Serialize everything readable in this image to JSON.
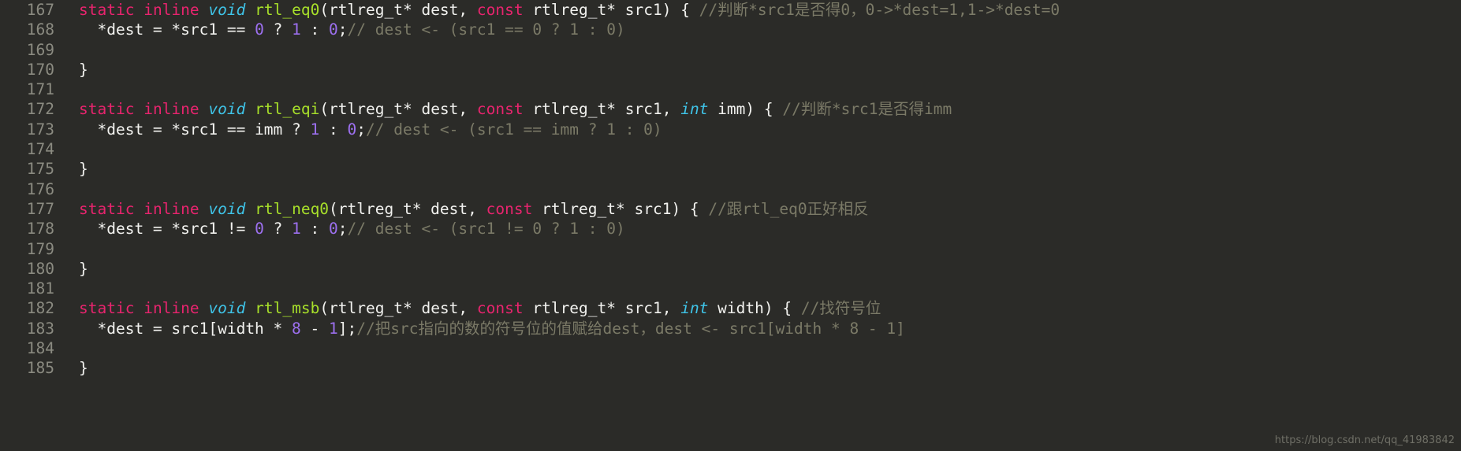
{
  "editor": {
    "background_color": "#2b2b28",
    "gutter_text_color": "#8b8b81",
    "font_size_px": 19.5,
    "line_height_px": 25.3,
    "palette": {
      "keyword": "#e8246e",
      "type": "#3fc4e8",
      "function": "#a8e02a",
      "plain": "#f2f2ef",
      "number": "#9d70f0",
      "comment": "#7b7a67"
    },
    "first_line_number": 167,
    "last_line_number": 185
  },
  "watermark": {
    "text": "https://blog.csdn.net/qq_41983842"
  },
  "lines": [
    {
      "num": "167",
      "guide": false,
      "tokens": [
        {
          "t": "static",
          "c": "kw"
        },
        {
          "t": " ",
          "c": "plain"
        },
        {
          "t": "inline",
          "c": "kw"
        },
        {
          "t": " ",
          "c": "plain"
        },
        {
          "t": "void",
          "c": "type"
        },
        {
          "t": " ",
          "c": "plain"
        },
        {
          "t": "rtl_eq0",
          "c": "fn"
        },
        {
          "t": "(rtlreg_t* dest, ",
          "c": "plain"
        },
        {
          "t": "const",
          "c": "kw"
        },
        {
          "t": " rtlreg_t* src1) { ",
          "c": "plain"
        },
        {
          "t": "//判断*src1是否得0，0->*dest=1,1->*dest=0",
          "c": "comment"
        }
      ]
    },
    {
      "num": "168",
      "guide": true,
      "tokens": [
        {
          "t": "  *dest = *src1 == ",
          "c": "plain"
        },
        {
          "t": "0",
          "c": "num"
        },
        {
          "t": " ? ",
          "c": "plain"
        },
        {
          "t": "1",
          "c": "num"
        },
        {
          "t": " : ",
          "c": "plain"
        },
        {
          "t": "0",
          "c": "num"
        },
        {
          "t": ";",
          "c": "plain"
        },
        {
          "t": "// dest <- (src1 == 0 ? 1 : 0)",
          "c": "comment"
        }
      ]
    },
    {
      "num": "169",
      "guide": false,
      "tokens": []
    },
    {
      "num": "170",
      "guide": false,
      "tokens": [
        {
          "t": "}",
          "c": "plain"
        }
      ]
    },
    {
      "num": "171",
      "guide": false,
      "tokens": []
    },
    {
      "num": "172",
      "guide": false,
      "tokens": [
        {
          "t": "static",
          "c": "kw"
        },
        {
          "t": " ",
          "c": "plain"
        },
        {
          "t": "inline",
          "c": "kw"
        },
        {
          "t": " ",
          "c": "plain"
        },
        {
          "t": "void",
          "c": "type"
        },
        {
          "t": " ",
          "c": "plain"
        },
        {
          "t": "rtl_eqi",
          "c": "fn"
        },
        {
          "t": "(rtlreg_t* dest, ",
          "c": "plain"
        },
        {
          "t": "const",
          "c": "kw"
        },
        {
          "t": " rtlreg_t* src1, ",
          "c": "plain"
        },
        {
          "t": "int",
          "c": "type"
        },
        {
          "t": " imm) { ",
          "c": "plain"
        },
        {
          "t": "//判断*src1是否得imm",
          "c": "comment"
        }
      ]
    },
    {
      "num": "173",
      "guide": true,
      "tokens": [
        {
          "t": "  *dest = *src1 == imm ? ",
          "c": "plain"
        },
        {
          "t": "1",
          "c": "num"
        },
        {
          "t": " : ",
          "c": "plain"
        },
        {
          "t": "0",
          "c": "num"
        },
        {
          "t": ";",
          "c": "plain"
        },
        {
          "t": "// dest <- (src1 == imm ? 1 : 0)",
          "c": "comment"
        }
      ]
    },
    {
      "num": "174",
      "guide": false,
      "tokens": []
    },
    {
      "num": "175",
      "guide": false,
      "tokens": [
        {
          "t": "}",
          "c": "plain"
        }
      ]
    },
    {
      "num": "176",
      "guide": false,
      "tokens": []
    },
    {
      "num": "177",
      "guide": false,
      "tokens": [
        {
          "t": "static",
          "c": "kw"
        },
        {
          "t": " ",
          "c": "plain"
        },
        {
          "t": "inline",
          "c": "kw"
        },
        {
          "t": " ",
          "c": "plain"
        },
        {
          "t": "void",
          "c": "type"
        },
        {
          "t": " ",
          "c": "plain"
        },
        {
          "t": "rtl_neq0",
          "c": "fn"
        },
        {
          "t": "(rtlreg_t* dest, ",
          "c": "plain"
        },
        {
          "t": "const",
          "c": "kw"
        },
        {
          "t": " rtlreg_t* src1) { ",
          "c": "plain"
        },
        {
          "t": "//跟rtl_eq0正好相反",
          "c": "comment"
        }
      ]
    },
    {
      "num": "178",
      "guide": true,
      "tokens": [
        {
          "t": "  *dest = *src1 != ",
          "c": "plain"
        },
        {
          "t": "0",
          "c": "num"
        },
        {
          "t": " ? ",
          "c": "plain"
        },
        {
          "t": "1",
          "c": "num"
        },
        {
          "t": " : ",
          "c": "plain"
        },
        {
          "t": "0",
          "c": "num"
        },
        {
          "t": ";",
          "c": "plain"
        },
        {
          "t": "// dest <- (src1 != 0 ? 1 : 0)",
          "c": "comment"
        }
      ]
    },
    {
      "num": "179",
      "guide": false,
      "tokens": []
    },
    {
      "num": "180",
      "guide": false,
      "tokens": [
        {
          "t": "}",
          "c": "plain"
        }
      ]
    },
    {
      "num": "181",
      "guide": false,
      "tokens": []
    },
    {
      "num": "182",
      "guide": false,
      "tokens": [
        {
          "t": "static",
          "c": "kw"
        },
        {
          "t": " ",
          "c": "plain"
        },
        {
          "t": "inline",
          "c": "kw"
        },
        {
          "t": " ",
          "c": "plain"
        },
        {
          "t": "void",
          "c": "type"
        },
        {
          "t": " ",
          "c": "plain"
        },
        {
          "t": "rtl_msb",
          "c": "fn"
        },
        {
          "t": "(rtlreg_t* dest, ",
          "c": "plain"
        },
        {
          "t": "const",
          "c": "kw"
        },
        {
          "t": " rtlreg_t* src1, ",
          "c": "plain"
        },
        {
          "t": "int",
          "c": "type"
        },
        {
          "t": " width) { ",
          "c": "plain"
        },
        {
          "t": "//找符号位",
          "c": "comment"
        }
      ]
    },
    {
      "num": "183",
      "guide": true,
      "tokens": [
        {
          "t": "  *dest = src1[width * ",
          "c": "plain"
        },
        {
          "t": "8",
          "c": "num"
        },
        {
          "t": " - ",
          "c": "plain"
        },
        {
          "t": "1",
          "c": "num"
        },
        {
          "t": "];",
          "c": "plain"
        },
        {
          "t": "//把src指向的数的符号位的值赋给dest，dest <- src1[width * 8 - 1]",
          "c": "comment"
        }
      ]
    },
    {
      "num": "184",
      "guide": false,
      "tokens": []
    },
    {
      "num": "185",
      "guide": false,
      "tokens": [
        {
          "t": "}",
          "c": "plain"
        }
      ]
    }
  ]
}
